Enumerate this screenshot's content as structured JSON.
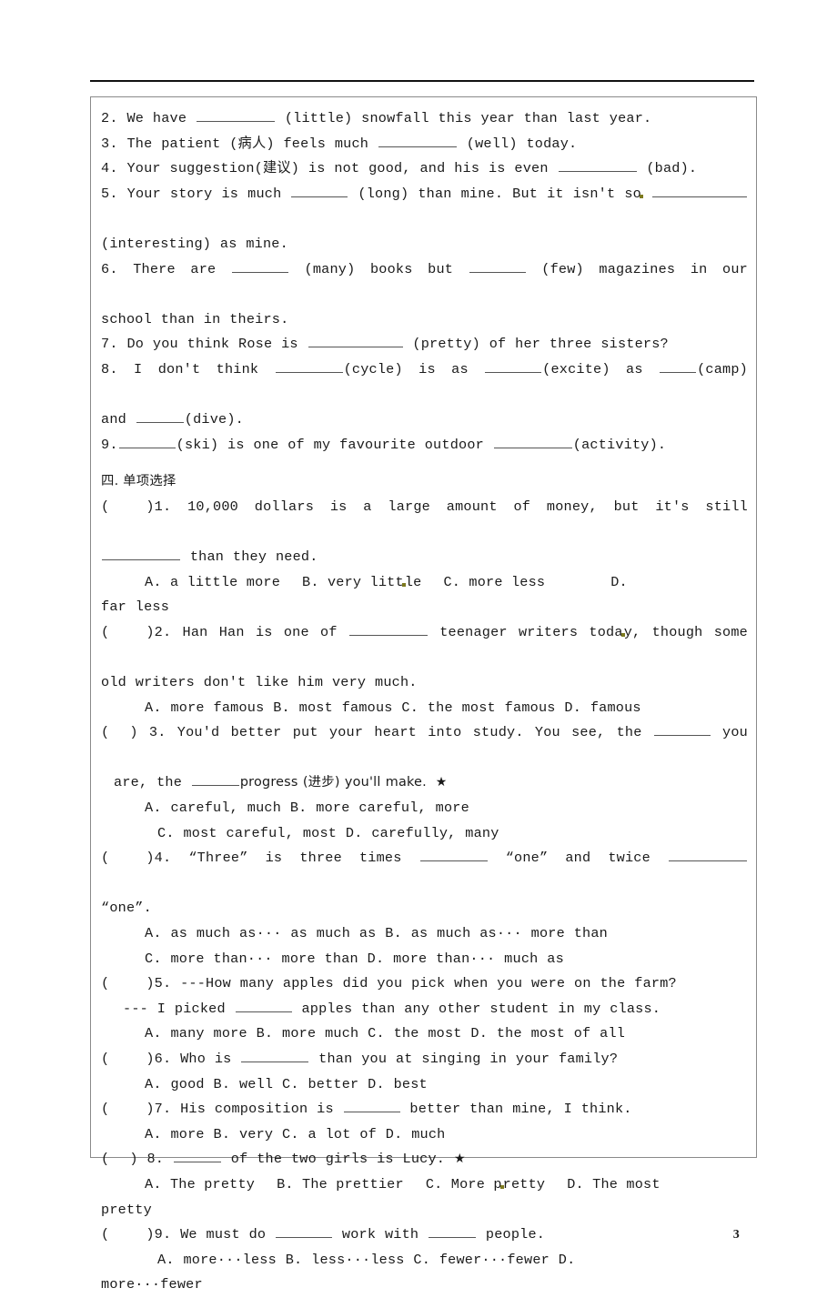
{
  "document": {
    "page_number": "3",
    "fill_in_section": {
      "items": [
        {
          "number": "2.",
          "segments": [
            "We have",
            "BLANK_L",
            "(little) snowfall this year than last year."
          ]
        },
        {
          "number": "3.",
          "segments": [
            "The patient (病人) feels much",
            "BLANK_L",
            "(well) today."
          ]
        },
        {
          "number": "4.",
          "segments": [
            "Your suggestion(建议) is not good, and his is even",
            "BLANK_L",
            "(bad)."
          ]
        },
        {
          "number": "5.",
          "line1_a": "Your story is much",
          "line1_b": "(long) than mine. But it isn't so",
          "line2": "(interesting) as mine."
        },
        {
          "number": "6.",
          "line1_a": "There are",
          "line1_b": "(many) books but",
          "line1_c": "(few) magazines in our",
          "line2": "school than in theirs."
        },
        {
          "number": "7.",
          "segments": [
            "Do you think Rose is",
            "BLANK_XL",
            "(pretty) of her three sisters?"
          ]
        },
        {
          "number": "8.",
          "line1_a": "I don't think",
          "line1_b": "(cycle) is as",
          "line1_c": "(excite) as",
          "line1_d": "(camp)",
          "line2_a": "and",
          "line2_b": "(dive)."
        },
        {
          "number": "9.",
          "line_a": "(ski) is one of my favourite outdoor",
          "line_b": "(activity)."
        }
      ]
    },
    "choice_section": {
      "heading": "四. 单项选择",
      "questions": [
        {
          "marker": "(",
          "close": ")1.",
          "stem_line1": "10,000 dollars is a large amount of money, but it's still",
          "stem_line2": "than they need.",
          "options_line1": [
            "A. a little more",
            "B. very litt",
            "le",
            "C. more less",
            "D."
          ],
          "options_line2": "far less",
          "star": ""
        },
        {
          "marker": "(",
          "close": ")2.",
          "stem_line1_a": "Han Han is one of",
          "stem_line1_b": "teenager writers toda",
          "stem_line1_c": "y, though some",
          "stem_line2": "old writers don't like him very much.",
          "options": "A. more famous        B. most famous  C. the most famous  D. famous",
          "star": ""
        },
        {
          "marker": "(",
          "close": ") 3.",
          "stem_line1_a": "You'd better put your heart into study. You see, the",
          "stem_line1_b": "you",
          "stem_line2_a": "are, the",
          "stem_line2_b": "progress (进步) you'll make.",
          "star": "★",
          "options_line1": "A. careful, much           B. more careful, more",
          "options_line2": "C. most careful, most       D. carefully, many"
        },
        {
          "marker": "(",
          "close": ")4.",
          "stem_line1_a": "“Three” is three times",
          "stem_line1_b": "“one” and twice",
          "stem_line2": "“one”.",
          "options_line1": "A. as much as··· as much as     B. as much as··· more than",
          "options_line2": "C. more than··· more than       D. more than··· much as",
          "star": ""
        },
        {
          "marker": "(",
          "close": ")5.",
          "stem_line1": "---How many apples did you pick when you were on the farm?",
          "stem_line2_a": "--- I picked",
          "stem_line2_b": "apples than any other student in my class.",
          "options": "A. many more      B. more much      C. the most D. the most of all",
          "star": ""
        },
        {
          "marker": "(",
          "close": ")6.",
          "stem_a": "Who is",
          "stem_b": "than you at singing in your family?",
          "options": "A. good           B. well            C. better           D. best",
          "star": ""
        },
        {
          "marker": "(",
          "close": ")7.",
          "stem_a": "His composition is",
          "stem_b": "better than mine, I think.",
          "options": "A. more           B. very            C. a lot of         D. much",
          "star": ""
        },
        {
          "marker": "(",
          "close": ") 8.",
          "stem_b": "of the two girls is Lucy.",
          "star": "★",
          "options_line1": [
            "A. The pretty",
            "B. The prettier",
            "C. More p",
            "retty",
            "D. The most"
          ],
          "options_line2": "pretty"
        },
        {
          "marker": "(",
          "close": ")9.",
          "stem_a": "We must do",
          "stem_b": "work with",
          "stem_c": "people.",
          "options_line1": "A. more···less    B. less···less        C. fewer···fewer     D.",
          "options_line2": "more···fewer"
        }
      ]
    }
  }
}
